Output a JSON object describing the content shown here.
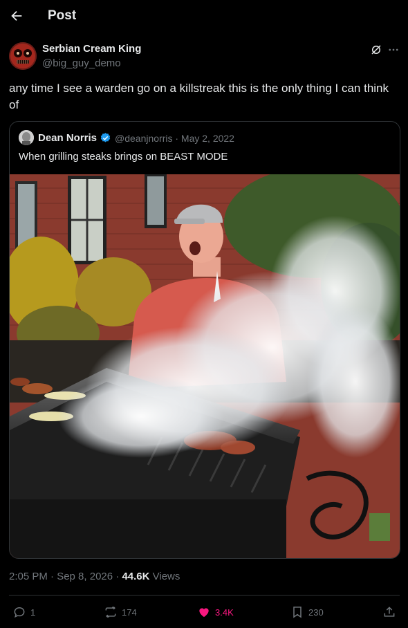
{
  "header": {
    "title": "Post",
    "back_icon": "arrow-left-icon"
  },
  "post": {
    "author_name": "Serbian Cream King",
    "author_handle": "@big_guy_demo",
    "text": "any time I see a warden go on a killstreak this is the only thing I can think of",
    "timestamp": "2:05 PM · Sep 8, 2026 · ",
    "views_count": "44.6K",
    "views_label": "Views"
  },
  "quote": {
    "author_name": "Dean Norris",
    "author_handle_date": "@deanjnorris · May 2, 2022",
    "text": "When grilling steaks brings on BEAST MODE",
    "image_alt": "Man yelling while grilling meat on a smoking grill"
  },
  "actions": {
    "replies": "1",
    "reposts": "174",
    "likes": "3.4K",
    "bookmarks": "230"
  },
  "colors": {
    "background": "#000000",
    "text_primary": "#e7e9ea",
    "text_secondary": "#71767b",
    "border": "#2f3336",
    "like_pink": "#f91880",
    "verified_blue": "#1d9bf0"
  }
}
